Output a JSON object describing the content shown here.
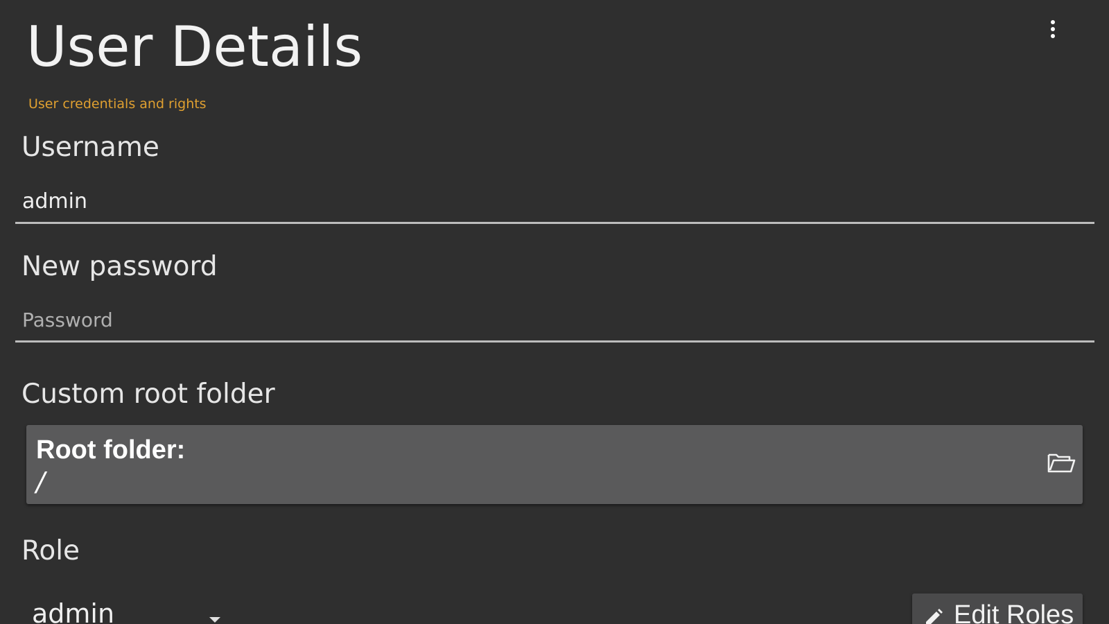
{
  "header": {
    "title": "User Details",
    "subtitle": "User credentials and rights",
    "menu_icon": "more-vertical-icon"
  },
  "username": {
    "label": "Username",
    "value": "admin"
  },
  "password": {
    "label": "New password",
    "placeholder": "Password",
    "value": ""
  },
  "root_folder": {
    "section_label": "Custom root folder",
    "title": "Root folder:",
    "path": "/",
    "icon": "folder-open-icon"
  },
  "role": {
    "label": "Role",
    "selected": "admin",
    "edit_button_label": "Edit Roles",
    "edit_icon": "pencil-icon"
  },
  "colors": {
    "background": "#2f2f2f",
    "subtitle": "#e0a030",
    "panel": "#5a5a5b",
    "underline": "#bdbdbd"
  }
}
